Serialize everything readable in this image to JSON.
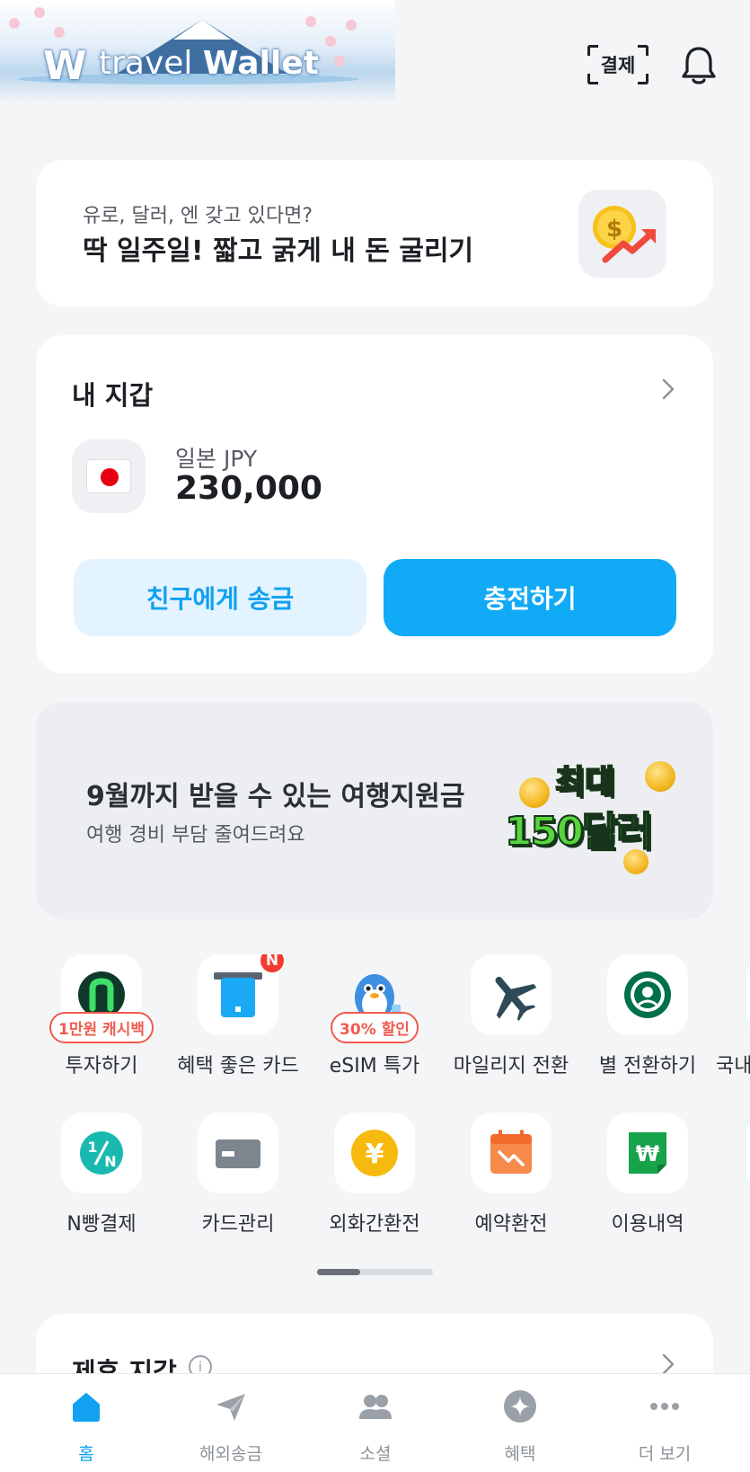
{
  "header": {
    "logo_text_light": "travel ",
    "logo_text_bold": "Wallet",
    "pay_label": "결제"
  },
  "promo": {
    "subtitle": "유로, 달러, 엔 갖고 있다면?",
    "title": "딱 일주일! 짧고 굵게 내 돈 굴리기"
  },
  "wallet": {
    "title": "내 지갑",
    "currency": "일본 JPY",
    "amount": "230,000",
    "send_label": "친구에게 송금",
    "charge_label": "충전하기"
  },
  "banner": {
    "title": "9월까지 받을 수 있는 여행지원금",
    "subtitle": "여행 경비 부담 줄여드려요",
    "art_line1": "최대",
    "art_line2": "150달러"
  },
  "services_row1": [
    {
      "label": "투자하기",
      "badge": "1만원 캐시백",
      "icon": "n-invest-icon"
    },
    {
      "label": "혜택 좋은 카드",
      "new": "N",
      "icon": "card-benefit-icon"
    },
    {
      "label": "eSIM 특가",
      "badge": "30% 할인",
      "icon": "penguin-esim-icon"
    },
    {
      "label": "마일리지 전환",
      "icon": "airplane-icon"
    },
    {
      "label": "별 전환하기",
      "icon": "starbucks-icon"
    },
    {
      "label": "국내",
      "icon": "partial-icon"
    }
  ],
  "services_row2": [
    {
      "label": "N빵결제",
      "icon": "split-pay-icon"
    },
    {
      "label": "카드관리",
      "icon": "card-icon"
    },
    {
      "label": "외화간환전",
      "icon": "yen-coin-icon"
    },
    {
      "label": "예약환전",
      "icon": "calendar-exchange-icon"
    },
    {
      "label": "이용내역",
      "icon": "won-receipt-icon"
    }
  ],
  "partner": {
    "title": "제휴 지갑"
  },
  "nav": [
    {
      "label": "홈",
      "icon": "home-icon",
      "active": true
    },
    {
      "label": "해외송금",
      "icon": "send-plane-icon"
    },
    {
      "label": "소셜",
      "icon": "people-icon"
    },
    {
      "label": "혜택",
      "icon": "benefit-star-icon"
    },
    {
      "label": "더 보기",
      "icon": "more-dots-icon"
    }
  ],
  "colors": {
    "accent": "#11aaf7",
    "accent_light": "#e3f3ff",
    "badge_red": "#f05a4e",
    "background": "#f4f5f7"
  }
}
